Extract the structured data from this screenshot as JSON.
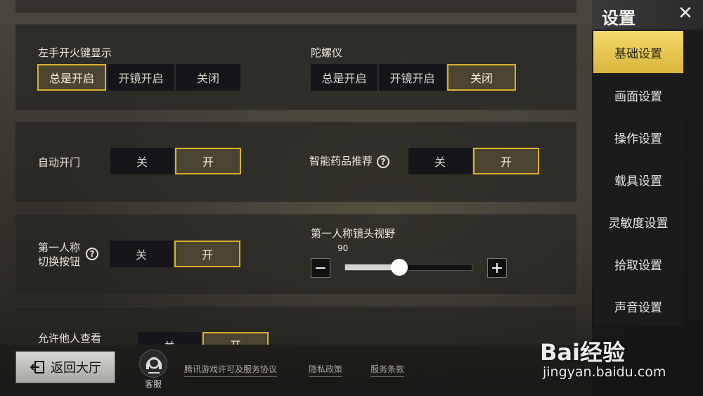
{
  "settings": {
    "fire_display": {
      "label": "左手开火键显示",
      "options": [
        "总是开启",
        "开镜开启",
        "关闭"
      ],
      "selected": "总是开启"
    },
    "gyro": {
      "label": "陀螺仪",
      "options": [
        "总是开启",
        "开镜开启",
        "关闭"
      ],
      "selected": "关闭"
    },
    "auto_door": {
      "label": "自动开门",
      "options": [
        "关",
        "开"
      ],
      "selected": "开"
    },
    "med_recommend": {
      "label": "智能药品推荐",
      "options": [
        "关",
        "开"
      ],
      "selected": "开"
    },
    "fpp_toggle": {
      "label_line1": "第一人称",
      "label_line2": "切换按钮",
      "options": [
        "关",
        "开"
      ],
      "selected": "开"
    },
    "fpp_fov": {
      "label": "第一人称镜头视野",
      "value": "90",
      "fraction": 0.43,
      "minus": "−",
      "plus": "+"
    },
    "allow_view": {
      "label": "允许他人查看",
      "options": [
        "关",
        "开"
      ],
      "selected": "开"
    },
    "help_icon": "?"
  },
  "sidebar": {
    "title": "设置",
    "close": "✕",
    "items": [
      "基础设置",
      "画面设置",
      "操作设置",
      "载具设置",
      "灵敏度设置",
      "拾取设置",
      "声音设置"
    ],
    "active": "基础设置"
  },
  "footer": {
    "back": "返回大厅",
    "support": "客服",
    "links": [
      "腾讯游戏许可及服务协议",
      "隐私政策",
      "服务条款"
    ]
  },
  "watermark": {
    "brand": "Bai经验",
    "url": "jingyan.baidu.com"
  },
  "colors": {
    "accent": "#d9b02c",
    "active_tab": "#f0d060"
  }
}
